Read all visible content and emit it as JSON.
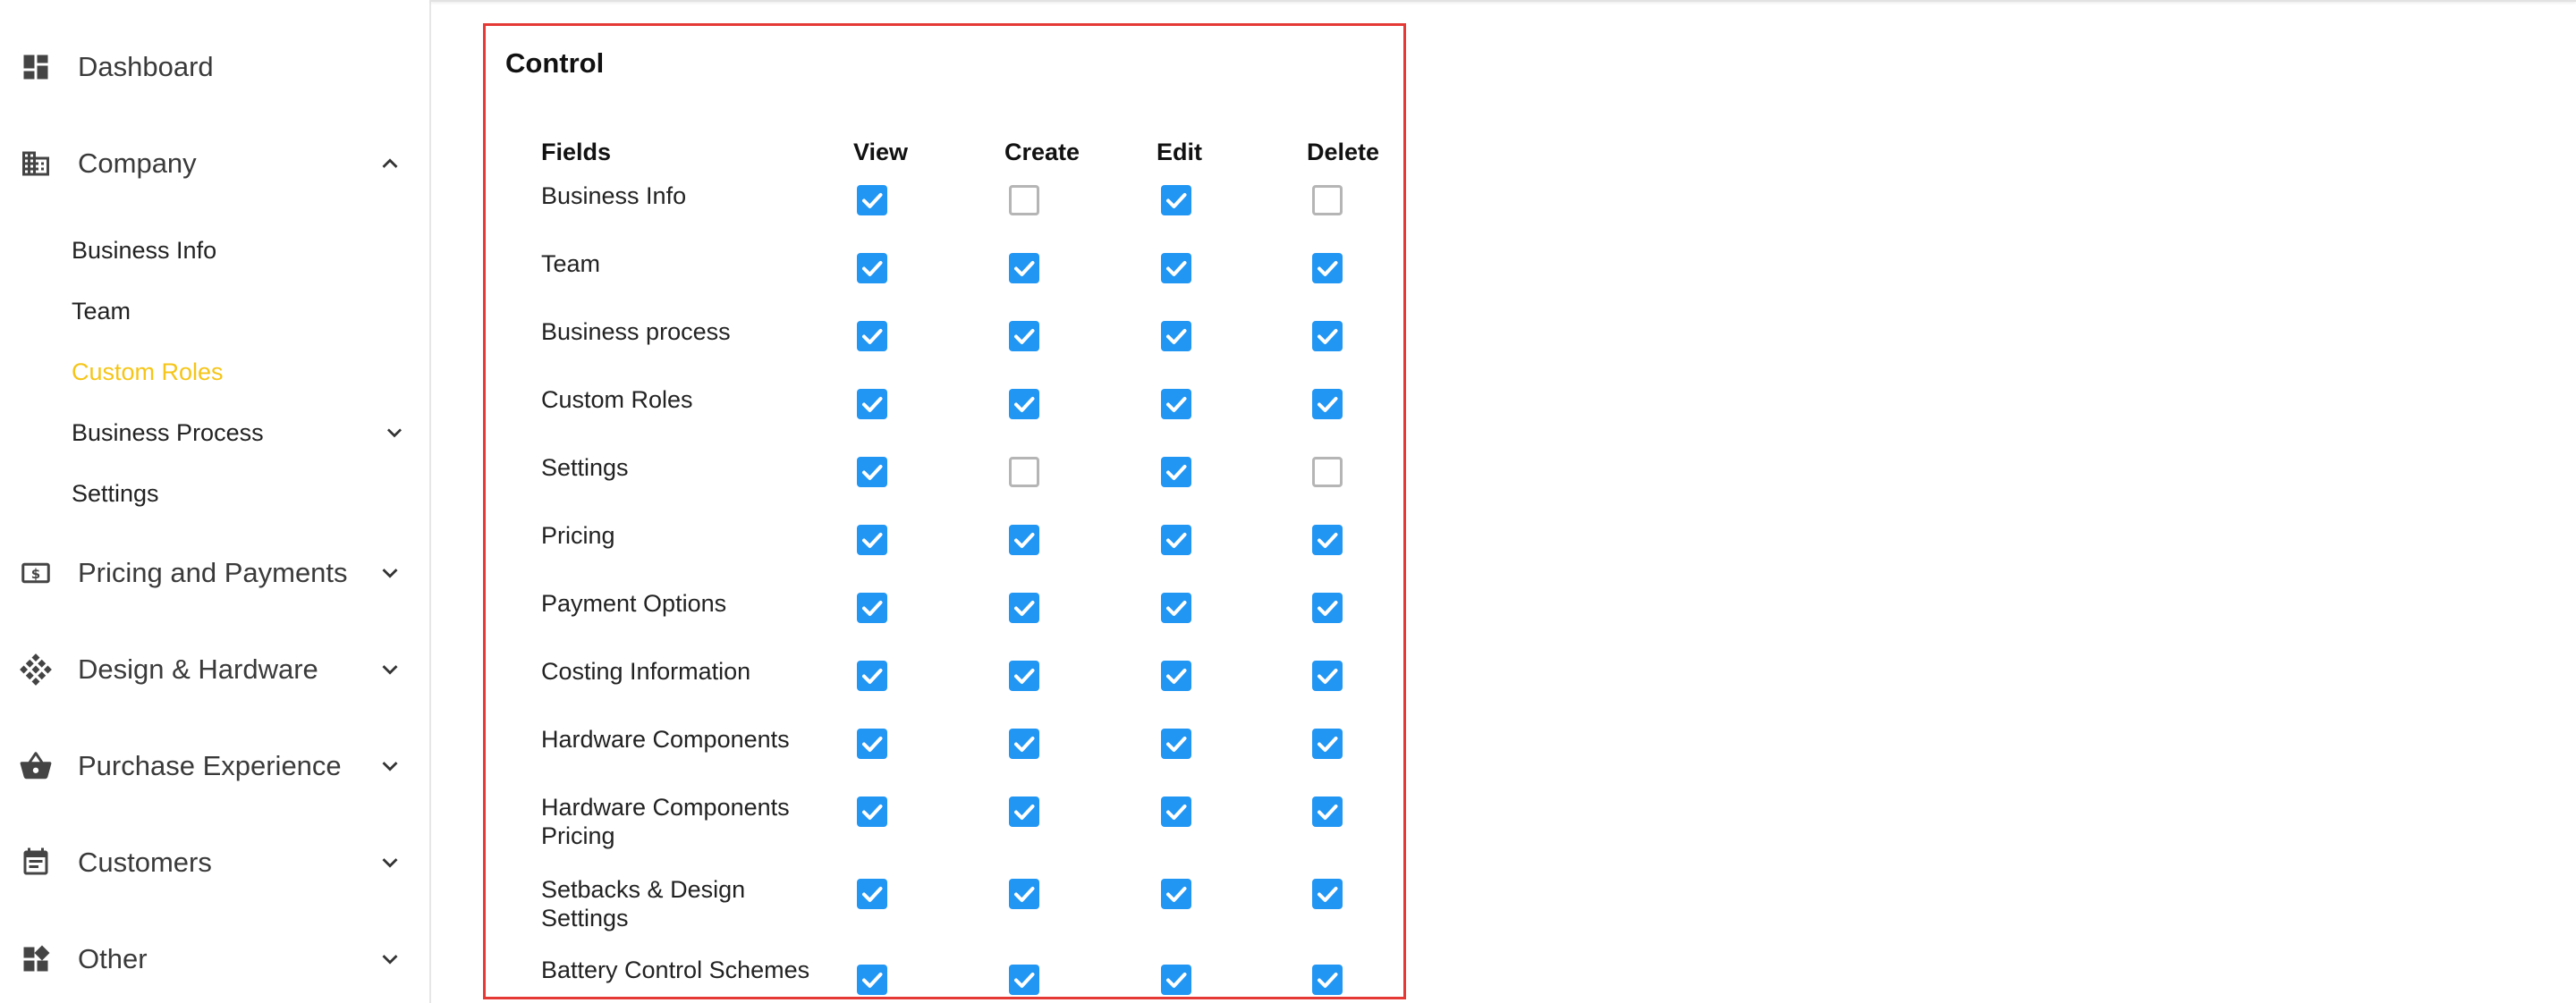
{
  "sidebar": {
    "items": [
      {
        "label": "Dashboard",
        "icon": "dashboard-icon"
      },
      {
        "label": "Company",
        "icon": "building-icon",
        "expanded": true
      },
      {
        "label": "Pricing and Payments",
        "icon": "dollar-bill-icon"
      },
      {
        "label": "Design & Hardware",
        "icon": "grid-diamond-icon"
      },
      {
        "label": "Purchase Experience",
        "icon": "basket-icon"
      },
      {
        "label": "Customers",
        "icon": "calendar-list-icon"
      },
      {
        "label": "Other",
        "icon": "widgets-icon"
      }
    ],
    "company_sub": [
      {
        "label": "Business Info"
      },
      {
        "label": "Team"
      },
      {
        "label": "Custom Roles",
        "active": true
      },
      {
        "label": "Business Process",
        "has_children": true
      },
      {
        "label": "Settings"
      }
    ],
    "active_color": "#f5c518"
  },
  "control": {
    "title": "Control",
    "headers": {
      "fields": "Fields",
      "view": "View",
      "create": "Create",
      "edit": "Edit",
      "delete": "Delete"
    },
    "rows": [
      {
        "label": "Business Info",
        "view": true,
        "create": false,
        "edit": true,
        "delete": false
      },
      {
        "label": "Team",
        "view": true,
        "create": true,
        "edit": true,
        "delete": true
      },
      {
        "label": "Business process",
        "view": true,
        "create": true,
        "edit": true,
        "delete": true
      },
      {
        "label": "Custom Roles",
        "view": true,
        "create": true,
        "edit": true,
        "delete": true
      },
      {
        "label": "Settings",
        "view": true,
        "create": false,
        "edit": true,
        "delete": false
      },
      {
        "label": "Pricing",
        "view": true,
        "create": true,
        "edit": true,
        "delete": true
      },
      {
        "label": "Payment Options",
        "view": true,
        "create": true,
        "edit": true,
        "delete": true
      },
      {
        "label": "Costing Information",
        "view": true,
        "create": true,
        "edit": true,
        "delete": true
      },
      {
        "label": "Hardware Components",
        "view": true,
        "create": true,
        "edit": true,
        "delete": true
      },
      {
        "label": "Hardware Components Pricing",
        "view": true,
        "create": true,
        "edit": true,
        "delete": true
      },
      {
        "label": "Setbacks & Design Settings",
        "view": true,
        "create": true,
        "edit": true,
        "delete": true
      },
      {
        "label": "Battery Control Schemes",
        "view": true,
        "create": true,
        "edit": true,
        "delete": true
      }
    ],
    "checked_color": "#2196f3",
    "border_color": "#e53935"
  }
}
